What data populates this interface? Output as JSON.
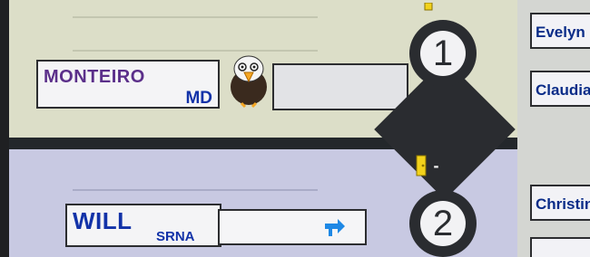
{
  "rooms": [
    {
      "number": "1",
      "provider_name": "MONTEIRO",
      "provider_role": "MD",
      "provider_color": "#5b2f8a",
      "avatar": "eagle-mascot-icon"
    },
    {
      "number": "2",
      "provider_name": "WILL",
      "provider_role": "SRNA",
      "provider_color": "#1232a8",
      "status_icon": "arrow-right-icon"
    }
  ],
  "door_status": "-",
  "right_column": {
    "names": [
      "Evelyn",
      "Claudia",
      "Christin"
    ]
  },
  "colors": {
    "top_panel": "#dcdec8",
    "bottom_panel": "#c8c9e2",
    "dark": "#2a2c30",
    "accent_blue": "#1e88e5",
    "door_yellow": "#f2d21b"
  }
}
